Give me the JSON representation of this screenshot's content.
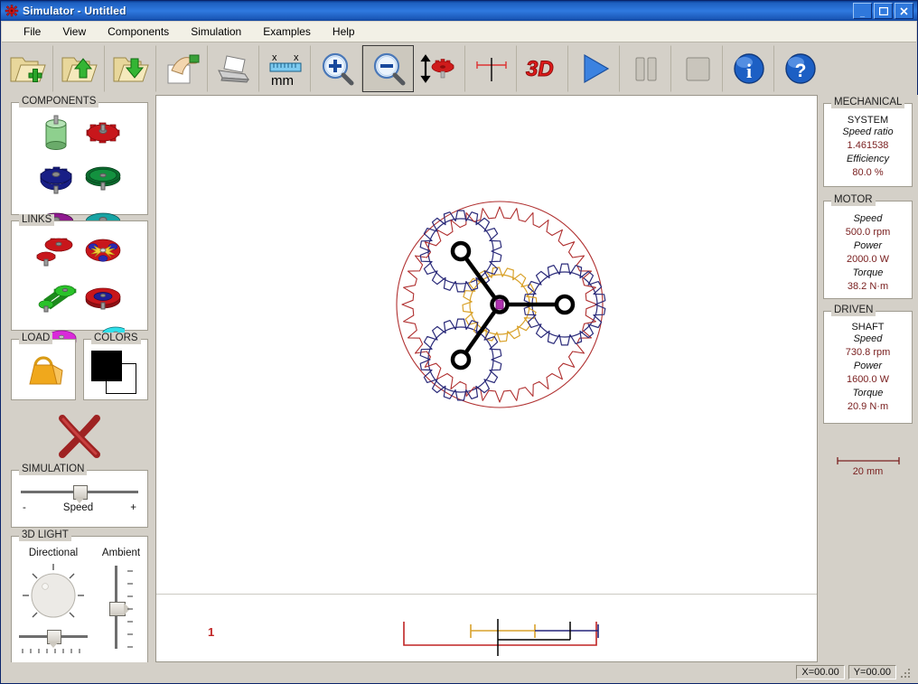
{
  "window": {
    "title": "Simulator - Untitled",
    "icon": "app-gear-icon",
    "controls": {
      "minimize": "_",
      "maximize": "□",
      "close": "✕"
    }
  },
  "menu": {
    "items": [
      "File",
      "View",
      "Components",
      "Simulation",
      "Examples",
      "Help"
    ]
  },
  "toolbar": {
    "buttons": [
      {
        "name": "new-file-button",
        "icon": "folder-plus-icon",
        "label": "New",
        "selected": false
      },
      {
        "name": "open-file-button",
        "icon": "folder-up-icon",
        "label": "Open",
        "selected": false
      },
      {
        "name": "save-file-button",
        "icon": "folder-down-icon",
        "label": "Save",
        "selected": false
      },
      {
        "name": "select-tool-button",
        "icon": "hand-page-icon",
        "label": "Select",
        "selected": false
      },
      {
        "name": "print-button",
        "icon": "printer-icon",
        "label": "Print",
        "selected": false
      },
      {
        "name": "units-button",
        "icon": "ruler-mm-icon",
        "label": "mm",
        "selected": false
      },
      {
        "name": "zoom-in-button",
        "icon": "magnifier-plus-icon",
        "label": "Zoom In",
        "selected": false
      },
      {
        "name": "zoom-out-button",
        "icon": "magnifier-minus-icon",
        "label": "Zoom Out",
        "selected": true
      },
      {
        "name": "gear-height-button",
        "icon": "arrow-gear-icon",
        "label": "Gear Position",
        "selected": false
      },
      {
        "name": "dimension-button",
        "icon": "dimension-line-icon",
        "label": "Dimension",
        "selected": false
      },
      {
        "name": "view-3d-button",
        "icon": "3d-icon",
        "label": "3D",
        "selected": false
      },
      {
        "name": "play-button",
        "icon": "play-triangle-icon",
        "label": "Play",
        "selected": false
      },
      {
        "name": "pause-button",
        "icon": "pause-bars-icon",
        "label": "Pause",
        "selected": false
      },
      {
        "name": "stop-button",
        "icon": "stop-square-icon",
        "label": "Stop",
        "selected": false
      },
      {
        "name": "info-button",
        "icon": "info-circle-icon",
        "label": "Info",
        "selected": false
      },
      {
        "name": "help-button",
        "icon": "question-circle-icon",
        "label": "Help",
        "selected": false
      }
    ],
    "units_label": "mm",
    "view3d_label": "3D"
  },
  "left_panel": {
    "components": {
      "title": "COMPONENTS",
      "items": [
        {
          "name": "component-motor",
          "icon": "green-cylinder-motor-icon"
        },
        {
          "name": "component-spur-gear",
          "icon": "red-spur-gear-icon"
        },
        {
          "name": "component-helical-gear",
          "icon": "blue-helical-gear-icon"
        },
        {
          "name": "component-ring-gear",
          "icon": "green-ring-gear-icon"
        },
        {
          "name": "component-disc",
          "icon": "purple-disc-icon"
        },
        {
          "name": "component-pulley",
          "icon": "teal-pulley-icon"
        }
      ]
    },
    "links": {
      "title": "LINKS",
      "items": [
        {
          "name": "link-gear-pair",
          "icon": "red-gear-pair-icon"
        },
        {
          "name": "link-planetary",
          "icon": "planetary-carrier-icon"
        },
        {
          "name": "link-chain",
          "icon": "green-chain-drive-icon"
        },
        {
          "name": "link-internal-gear",
          "icon": "red-internal-gear-icon"
        },
        {
          "name": "link-friction",
          "icon": "magenta-friction-drive-icon"
        },
        {
          "name": "link-belt",
          "icon": "cyan-belt-drive-icon"
        }
      ]
    },
    "load": {
      "title": "LOAD",
      "icon": "orange-weight-icon"
    },
    "colors": {
      "title": "COLORS",
      "foreground": "#000000",
      "background": "#ffffff"
    },
    "delete": {
      "name": "delete-button",
      "icon": "red-x-icon"
    },
    "simulation": {
      "title": "SIMULATION",
      "minus": "-",
      "speed_label": "Speed",
      "plus": "+",
      "value_percent": 50
    },
    "light": {
      "title": "3D LIGHT",
      "directional_label": "Directional",
      "ambient_label": "Ambient",
      "directional_value_percent": 50,
      "ambient_value_percent": 50
    }
  },
  "canvas": {
    "drawing_label": "1",
    "gear_colors": {
      "ring": "#b03030",
      "sun": "#d9a22b",
      "planet": "#2b2b7a",
      "carrier": "#000000",
      "hub": "#b030b0"
    }
  },
  "right_panel": {
    "mechanical_system": {
      "title_line1": "MECHANICAL",
      "title_line2": "SYSTEM",
      "rows": [
        {
          "label": "Speed ratio",
          "value": "1.461538"
        },
        {
          "label": "Efficiency",
          "value": "80.0 %"
        }
      ]
    },
    "motor": {
      "title_line1": "MOTOR",
      "title_line2": "",
      "rows": [
        {
          "label": "Speed",
          "value": "500.0 rpm"
        },
        {
          "label": "Power",
          "value": "2000.0 W"
        },
        {
          "label": "Torque",
          "value": "38.2 N·m"
        }
      ]
    },
    "driven_shaft": {
      "title_line1": "DRIVEN",
      "title_line2": "SHAFT",
      "rows": [
        {
          "label": "Speed",
          "value": "730.8 rpm"
        },
        {
          "label": "Power",
          "value": "1600.0 W"
        },
        {
          "label": "Torque",
          "value": "20.9 N·m"
        }
      ]
    },
    "scale": {
      "label": "20 mm"
    }
  },
  "statusbar": {
    "x": "X=00.00",
    "y": "Y=00.00"
  }
}
